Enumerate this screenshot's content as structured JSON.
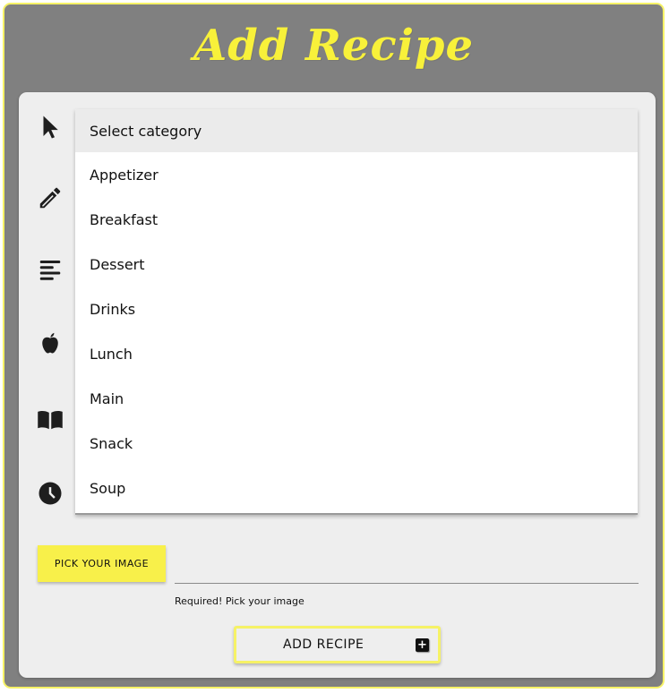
{
  "title": "Add Recipe",
  "sidebar_icons": [
    "cursor-icon",
    "pencil-icon",
    "align-left-icon",
    "apple-icon",
    "book-icon",
    "clock-icon"
  ],
  "category": {
    "placeholder": "Select category",
    "options": [
      "Appetizer",
      "Breakfast",
      "Dessert",
      "Drinks",
      "Lunch",
      "Main",
      "Snack",
      "Soup"
    ]
  },
  "image_picker": {
    "button_label": "PICK YOUR IMAGE",
    "value": "",
    "helper_text": "Required! Pick your image"
  },
  "submit": {
    "label": "ADD RECIPE",
    "icon": "plus-square-icon"
  },
  "colors": {
    "accent": "#f8f04a",
    "frame_bg": "#808080",
    "card_bg": "#eeeeee"
  }
}
